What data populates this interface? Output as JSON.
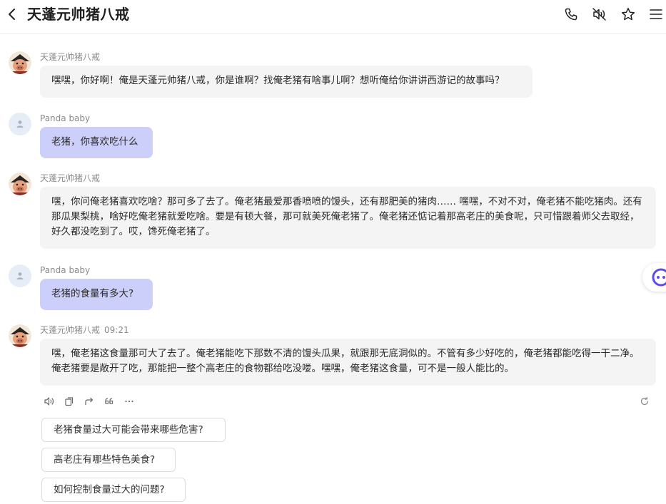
{
  "header": {
    "title": "天蓬元帅猪八戒",
    "icons": [
      "chevron-left-icon",
      "phone-icon",
      "speaker-mute-icon",
      "star-icon",
      "menu-icon"
    ]
  },
  "messages": [
    {
      "role": "bot",
      "sender": "天蓬元帅猪八戒",
      "time": "",
      "text": "嘿嘿，你好啊！俺是天蓬元帅猪八戒，你是谁啊？找俺老猪有啥事儿啊？想听俺给你讲讲西游记的故事吗？"
    },
    {
      "role": "user",
      "sender": "Panda baby",
      "time": "",
      "text": "老猪，你喜欢吃什么"
    },
    {
      "role": "bot",
      "sender": "天蓬元帅猪八戒",
      "time": "",
      "text": "嘿，你问俺老猪喜欢吃啥？那可多了去了。俺老猪最爱那香喷喷的馒头，还有那肥美的猪肉…… 嘿嘿，不对不对，俺老猪不能吃猪肉。还有那瓜果梨桃，啥好吃俺老猪就爱吃啥。要是有顿大餐，那可就美死俺老猪了。俺老猪还惦记着那高老庄的美食呢，只可惜跟着师父去取经，好久都没吃到了。哎，馋死俺老猪了。"
    },
    {
      "role": "user",
      "sender": "Panda baby",
      "time": "",
      "text": "老猪的食量有多大?"
    },
    {
      "role": "bot",
      "sender": "天蓬元帅猪八戒",
      "time": "09:21",
      "text": "嘿，俺老猪这食量那可大了去了。俺老猪能吃下那数不清的馒头瓜果，就跟那无底洞似的。不管有多少好吃的，俺老猪都能吃得一干二净。俺老猪要是敞开了吃，那能把一整个高老庄的食物都给吃没喽。嘿嘿，俺老猪这食量，可不是一般人能比的。"
    }
  ],
  "message_actions": [
    "speaker-icon",
    "copy-icon",
    "share-icon",
    "quote-icon",
    "more-icon",
    "refresh-icon"
  ],
  "suggestions": [
    "老猪食量过大可能会带来哪些危害?",
    "高老庄有哪些特色美食?",
    "如何控制食量过大的问题?"
  ],
  "colors": {
    "user_bubble": "#cdcffb",
    "bot_bubble": "#f4f4f5",
    "accent": "#5b4ee8"
  }
}
